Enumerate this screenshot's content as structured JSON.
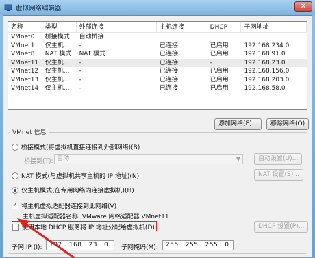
{
  "window": {
    "title": "虚拟网络编辑器"
  },
  "table": {
    "columns": [
      "名称",
      "类型",
      "外部连接",
      "主机连接",
      "DHCP",
      "子网地址"
    ],
    "rows": [
      [
        "VMnet0",
        "桥接模式",
        "自动桥接",
        "",
        "",
        ""
      ],
      [
        "VMnet1",
        "仅主机...",
        "-",
        "已连接",
        "已启用",
        "192.168.234.0"
      ],
      [
        "VMnet8",
        "NAT 模式",
        "NAT 模式",
        "已连接",
        "已启用",
        "192.168.91.0"
      ],
      [
        "VMnet11",
        "仅主机...",
        "-",
        "已连接",
        "-",
        "192.168.23.0"
      ],
      [
        "VMnet12",
        "仅主机...",
        "-",
        "已连接",
        "已启用",
        "192.168.156.0"
      ],
      [
        "VMnet13",
        "仅主机...",
        "-",
        "已连接",
        "已启用",
        "192.168.203.0"
      ],
      [
        "VMnet14",
        "仅主机...",
        "-",
        "已连接",
        "已启用",
        "192.168.58.0"
      ]
    ],
    "selected_row": 3
  },
  "buttons": {
    "add_network": "添加网络(E)...",
    "remove_network": "移除网络(O)",
    "auto_settings": "自动设置(U)...",
    "nat_settings": "NAT 设置(S)...",
    "dhcp_settings": "DHCP 设置(P)..."
  },
  "vmnet_info": {
    "title": "VMnet 信息",
    "bridge_radio": "桥接模式(将虚拟机直接连接到外部网络)(B)",
    "bridge_to_label": "桥接到(T):",
    "bridge_to_value": "自动",
    "nat_radio": "NAT 模式(与虚拟机共享主机的 IP 地址)(N)",
    "hostonly_radio": "仅主机模式(在专用网络内连接虚拟机)(H)",
    "selected_mode": "hostonly",
    "connect_adapter_checkbox": "将主机虚拟适配器连接到此网络(V)",
    "connect_adapter_checked": true,
    "adapter_name_label": "主机虚拟适配器名称: VMware 网络适配器 VMnet11",
    "dhcp_checkbox": "使用本地 DHCP 服务将 IP 地址分配给虚拟机(D)",
    "dhcp_checked": false,
    "subnet_ip_label": "子网 IP (I):",
    "subnet_ip_value": "192 . 168 . 23 . 0",
    "subnet_mask_label": "子网掩码(M):",
    "subnet_mask_value": "255 . 255 . 255 . 0"
  },
  "colors": {
    "annotation_red": "#e02020",
    "title_bar": "#7fb2de"
  }
}
